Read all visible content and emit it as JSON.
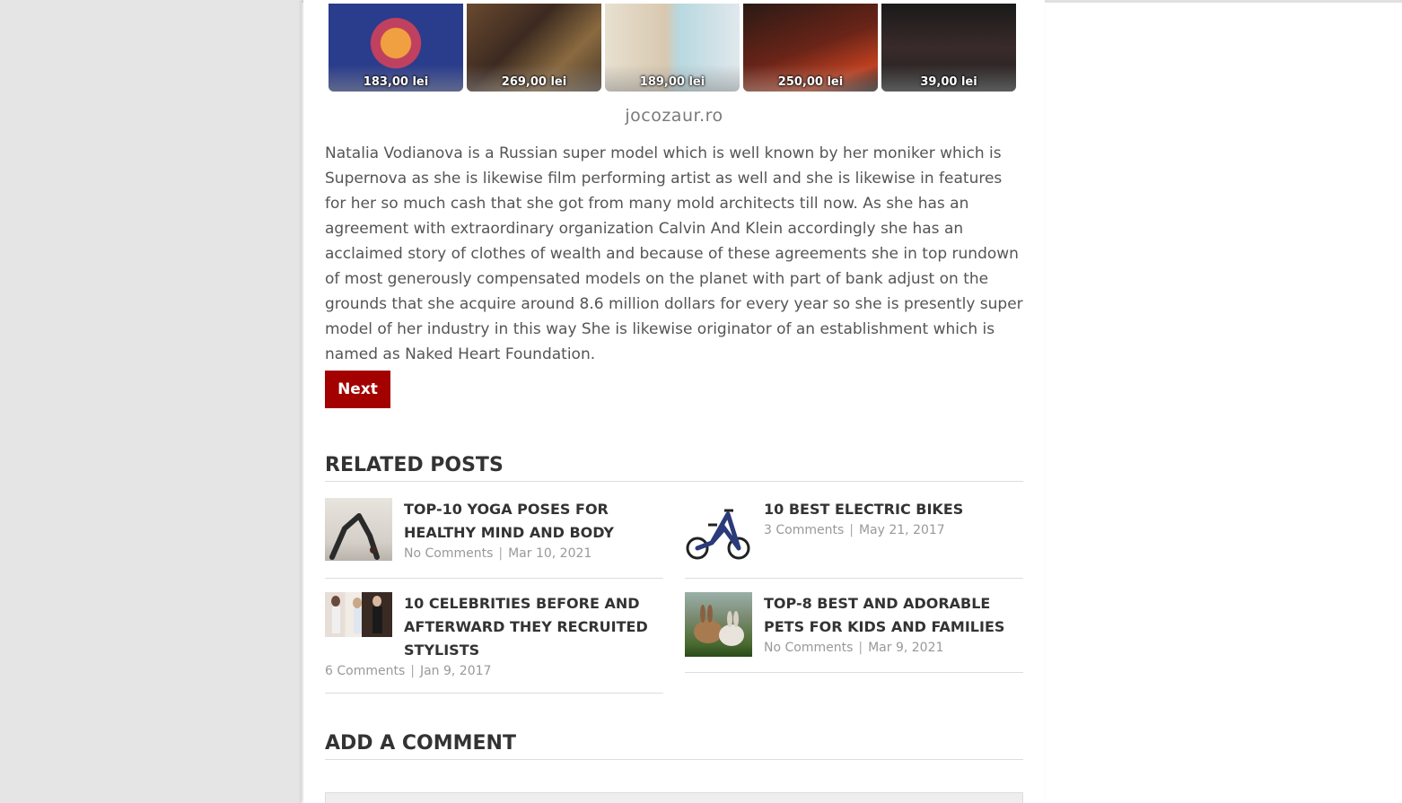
{
  "ads": {
    "prices": [
      "183,00 lei",
      "269,00 lei",
      "189,00 lei",
      "250,00 lei",
      "39,00 lei"
    ],
    "source": "jocozaur.ro"
  },
  "article": {
    "body": "Natalia Vodianova is a Russian super model which is well known by her moniker which is Supernova as she is likewise film performing artist as well and she is likewise in features for her so much cash that she got from many mold architects till now. As she has an agreement with extraordinary organization Calvin And Klein accordingly she has an acclaimed story of clothes of wealth and because of these agreements she in top rundown of most generously compensated models on the planet with part of bank adjust on the grounds that she acquire around 8.6 million dollars for every year so she is presently super model of her industry in this way She is likewise originator of an establishment which is named as Naked Heart Foundation.",
    "next_label": "Next"
  },
  "related": {
    "heading": "RELATED POSTS",
    "posts": [
      {
        "title": "TOP-10 YOGA POSES FOR HEALTHY MIND AND BODY",
        "comments": "No Comments",
        "date": "Mar 10, 2021"
      },
      {
        "title": "10 BEST ELECTRIC BIKES",
        "comments": "3 Comments",
        "date": "May 21, 2017"
      },
      {
        "title": "10 CELEBRITIES BEFORE AND AFTERWARD THEY RECRUITED STYLISTS",
        "comments": "6 Comments",
        "date": "Jan 9, 2017"
      },
      {
        "title": "TOP-8 BEST AND ADORABLE PETS FOR KIDS AND FAMILIES",
        "comments": "No Comments",
        "date": "Mar 9, 2021"
      }
    ],
    "separator": "|"
  },
  "comments": {
    "heading": "ADD A COMMENT"
  }
}
